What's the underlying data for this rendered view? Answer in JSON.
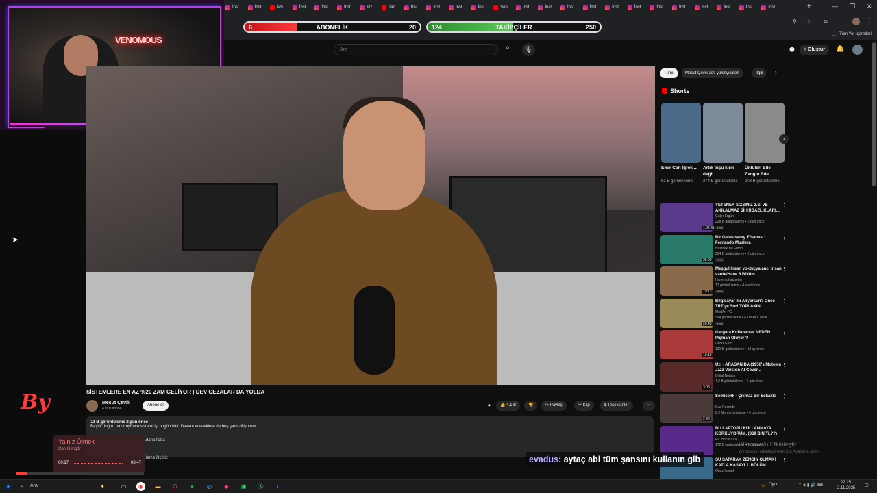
{
  "browser": {
    "tabs": [
      {
        "label": "İnst",
        "icon": "instagram-icon"
      },
      {
        "label": "İnst",
        "icon": "instagram-icon"
      },
      {
        "label": "Abi",
        "icon": "youtube-icon"
      },
      {
        "label": "İnst",
        "icon": "instagram-icon"
      },
      {
        "label": "İnst",
        "icon": "instagram-icon"
      },
      {
        "label": "İnst",
        "icon": "instagram-icon"
      },
      {
        "label": "Kız",
        "icon": "instagram-icon"
      },
      {
        "label": "Tan",
        "icon": "youtube-icon"
      },
      {
        "label": "İnst",
        "icon": "instagram-icon"
      },
      {
        "label": "İnst",
        "icon": "instagram-icon"
      },
      {
        "label": "İnst",
        "icon": "instagram-icon"
      },
      {
        "label": "İnst",
        "icon": "instagram-icon"
      },
      {
        "label": "Sen",
        "icon": "youtube-icon"
      },
      {
        "label": "İnst",
        "icon": "instagram-icon"
      },
      {
        "label": "İnst",
        "icon": "instagram-icon"
      },
      {
        "label": "İnst",
        "icon": "instagram-icon"
      },
      {
        "label": "İnst",
        "icon": "instagram-icon"
      },
      {
        "label": "İnst",
        "icon": "instagram-icon"
      },
      {
        "label": "İnst",
        "icon": "instagram-icon"
      },
      {
        "label": "İnst",
        "icon": "instagram-icon"
      },
      {
        "label": "İnst",
        "icon": "instagram-icon"
      },
      {
        "label": "İnst",
        "icon": "instagram-icon"
      },
      {
        "label": "İnst",
        "icon": "instagram-icon"
      },
      {
        "label": "İnst",
        "icon": "instagram-icon"
      },
      {
        "label": "İnst",
        "icon": "instagram-icon"
      }
    ],
    "new_tab": "+",
    "bookmarks_label": "Tüm Yer İşaretleri"
  },
  "overlay": {
    "subs_label": "ABONELİK",
    "subs_current": "6",
    "subs_goal": "20",
    "subs_progress": 0.3,
    "follow_label": "TAKİPÇİLER",
    "follow_current": "124",
    "follow_goal": "250",
    "follow_progress": 0.496,
    "webcam_neon": "VENOMOUS",
    "chat_user": "evadus",
    "chat_message": ": aytaç abi tüm şansını kullanın glb",
    "by_logo": "By"
  },
  "youtube": {
    "search_placeholder": "Ara",
    "create_label": "Oluştur",
    "video_title": "SİSTEMLERE EN AZ %20 ZAM GELİYOR | DEV CEZALAR DA YOLDA",
    "channel_name": "Mesut Çevik",
    "channel_subs": "413 B abone",
    "subscribe_label": "Abone ol",
    "like_count": "4,1 B",
    "share_label": "Paylaş",
    "clip_label": "Klip",
    "thanks_label": "Teşekkürler",
    "more_label": "⋯",
    "desc_meta": "72 B görüntüleme  2 gün önce",
    "desc_text": "Başlık doğru, hazır oyuncu sisterni işi bugün bitti. Devam edeceklere de boş şans diliyorum.",
    "desc_more": "...daha fazla",
    "desc_more2": "...lama ölçütü:",
    "chips": [
      "Tümü",
      "Mesut Çevik adlı yükleyiciden",
      "İlgili"
    ],
    "shorts_heading": "Shorts",
    "shorts": [
      {
        "title": "Emir Can İğrek ...",
        "views": "62 B görüntüleme",
        "color": "#4a6a8a"
      },
      {
        "title": "Artık tuşu kırık değil ...",
        "views": "274 B görüntüleme",
        "color": "#7d8a9a"
      },
      {
        "title": "Ünlüleri Bile Zengin Ede...",
        "views": "208 B görüntüleme",
        "color": "#8a8a8a"
      }
    ],
    "recommendations": [
      {
        "title": "YETENEK SİZSİNİZ 2.Si VE AKILALMAZ SİHİRBAZLIKLARI...",
        "channel": "Çağrı Ergün",
        "views": "228 B görüntüleme • 5 gün önce",
        "badge": "Yeni",
        "duration": "1:02:41",
        "color": "#5a3a8a"
      },
      {
        "title": "Bir Galatasaray Efsanesi: Fernando Muslera",
        "channel": "Hastalık Bu Futbol",
        "views": "234 B görüntüleme • 2 gün önce",
        "badge": "Yeni",
        "duration": "25:00",
        "color": "#2a7a6a"
      },
      {
        "title": "Meşgul insan yoktuçyalancı insan varde/Hane 6.Bölüm",
        "channel": "Hanemuhabbetleri",
        "views": "17 görüntüleme • 4 saat önce",
        "badge": "Yeni",
        "duration": "19:12",
        "color": "#8a6a4a"
      },
      {
        "title": "Bilgisayar mı Alıyorsun? Önce TRT'ye Sor! TOPLANIN ...",
        "channel": "ModArt PC",
        "views": "994 görüntüleme • 47 dakika önce",
        "badge": "Yeni",
        "duration": "26:45",
        "color": "#9a8a5a"
      },
      {
        "title": "Gargara Kullananlar NEDEN Pişman Oluyor ?",
        "channel": "Deniz Erdiz",
        "views": "120 B görüntüleme • 10 ay önce",
        "badge": "",
        "duration": "10:19",
        "color": "#aa3a3a"
      },
      {
        "title": "Uzi - ARASAN DA (1950's Motown Jazz Version AI Cover...",
        "channel": "Dijital Notalar",
        "views": "4,2 B görüntüleme • 7 gün önce",
        "badge": "",
        "duration": "3:03",
        "color": "#5a2a2a"
      },
      {
        "title": "Semicenk - Çıkmaz Bir Sokakta",
        "channel": "Eva Records",
        "views": "8,9 Mn görüntüleme • 9 gün önce",
        "badge": "",
        "duration": "2:43",
        "color": "#4a3a3a"
      },
      {
        "title": "BU LAPTOPU KULLANMAYA KORKUYORUM. (369 BİN TL??)",
        "channel": "PC Hocası TV",
        "views": "172 B görüntüleme • 3 gün önce",
        "badge": "",
        "duration": "",
        "color": "#5a2a8a"
      },
      {
        "title": "SU SATARAK ZENGİN OLMAK! KATLA KASAYI 1. BÖLÜM ...",
        "channel": "Oğuz Işımak",
        "views": "",
        "badge": "",
        "duration": "",
        "color": "#3a6a8a"
      }
    ]
  },
  "windows_activation": {
    "title": "Windows'u Etkinleştir",
    "subtitle": "Windows'u etkinleştirmek için Ayarlar'a gidin."
  },
  "spotify": {
    "song": "Yalnız Ölmek",
    "artist": "Can Güngör",
    "current_time": "00:17",
    "total_time": "03:47"
  },
  "taskbar": {
    "search_placeholder": "Ara",
    "weather": "Oyun",
    "time": "22:25",
    "date": "2.11.2025"
  }
}
